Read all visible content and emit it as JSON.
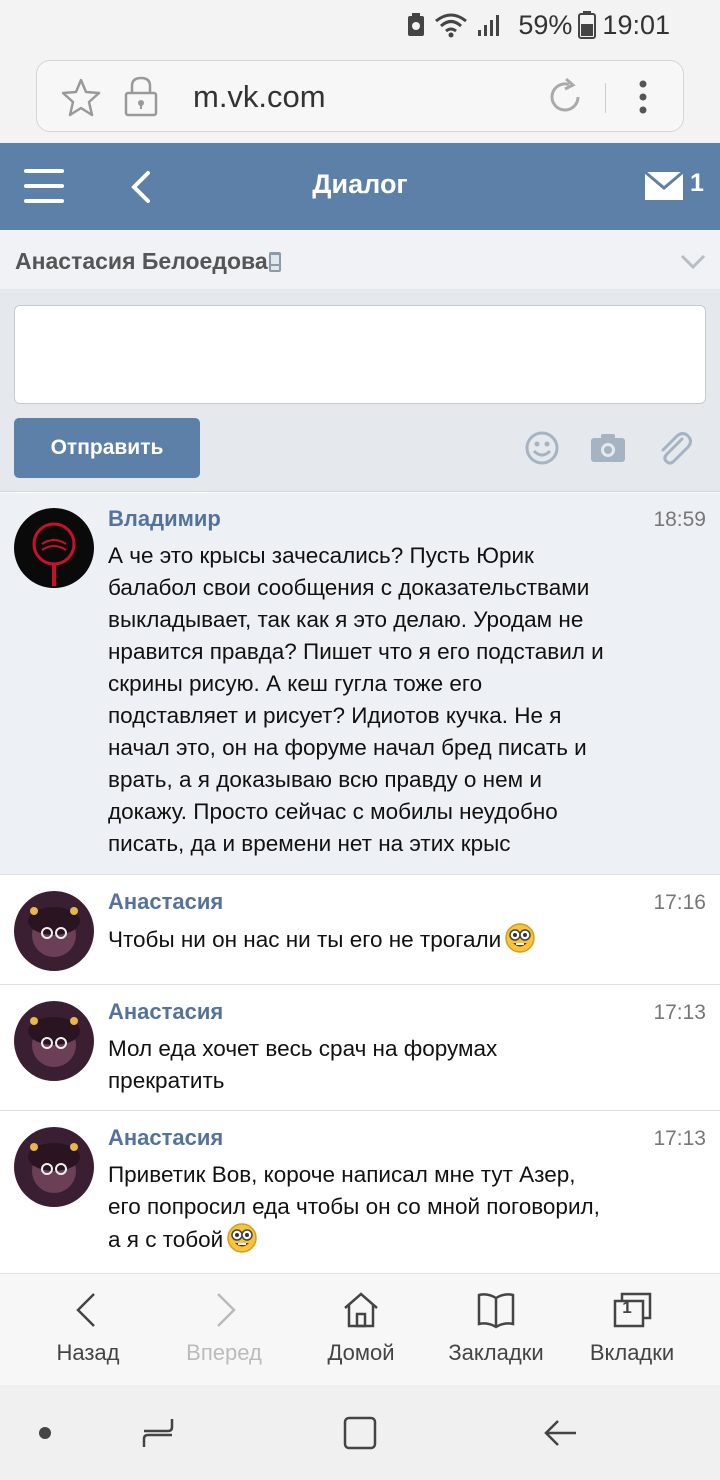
{
  "status_bar": {
    "battery": "59%",
    "time": "19:01"
  },
  "browser": {
    "url": "m.vk.com"
  },
  "header": {
    "title": "Диалог",
    "mail_count": "1"
  },
  "dialog": {
    "contact_name": "Анастасия Белоедова"
  },
  "compose": {
    "send_label": "Отправить",
    "message_value": ""
  },
  "messages": [
    {
      "author": "Владимир",
      "time": "18:59",
      "unread": true,
      "lines": [
        "А че это крысы зачесались? Пусть Юрик",
        "балабол свои сообщения с доказательствами",
        "выкладывает, так как я это делаю. Уродам не",
        "нравится правда? Пишет что я его подставил и",
        "скрины рисую. А кеш гугла тоже его",
        "подставляет и рисует? Идиотов кучка. Не я",
        "начал это, он на форуме начал бред писать и",
        "врать, а я доказываю всю правду о нем и",
        "докажу. Просто сейчас с мобилы неудобно",
        "писать, да и времени нет на этих крыс"
      ]
    },
    {
      "author": "Анастасия",
      "time": "17:16",
      "lines": [
        "Чтобы ни он нас ни ты его не трогали"
      ],
      "emoji": "nerd-face-emoji"
    },
    {
      "author": "Анастасия",
      "time": "17:13",
      "lines": [
        "Мол еда хочет весь срач на форумах",
        "прекратить"
      ]
    },
    {
      "author": "Анастасия",
      "time": "17:13",
      "lines": [
        "Приветик Вов, короче написал мне тут Азер,",
        "его попросил еда чтобы он со мной поговорил,",
        "а я с тобой"
      ],
      "emoji": "nerd-face-emoji"
    }
  ],
  "browser_bar": {
    "back": "Назад",
    "forward": "Вперед",
    "home": "Домой",
    "bookmarks": "Закладки",
    "tabs": "Вкладки",
    "tabs_count": "1"
  },
  "colors": {
    "vk_blue": "#5d80a8",
    "author_blue": "#55739a",
    "unread_bg": "#edf0f5"
  }
}
